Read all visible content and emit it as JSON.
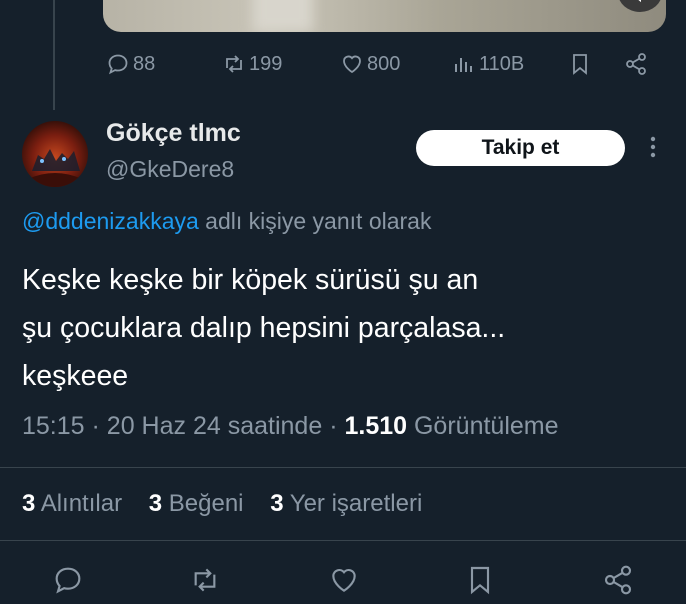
{
  "prev_tweet": {
    "replies": "88",
    "retweets": "199",
    "likes": "800",
    "views": "110B"
  },
  "tweet": {
    "author_name": "Gökçe tlmc",
    "author_handle": "@GkeDere8",
    "follow_label": "Takip et",
    "reply_mention": "@dddenizakkaya",
    "reply_suffix": " adlı kişiye yanıt olarak",
    "text": "Keşke keşke bir köpek sürüsü şu an\nşu çocuklara dalıp hepsini parçalasa...\nkeşkeee",
    "time": "15:15",
    "date": "20 Haz 24 saatinde",
    "views_count": "1.510",
    "views_label": "Görüntüleme"
  },
  "stats": {
    "quotes_count": "3",
    "quotes_label": "Alıntılar",
    "likes_count": "3",
    "likes_label": "Beğeni",
    "bookmarks_count": "3",
    "bookmarks_label": "Yer işaretleri"
  },
  "icons": [
    "reply-icon",
    "retweet-icon",
    "like-icon",
    "views-icon",
    "bookmark-icon",
    "share-icon",
    "more-icon",
    "mute-icon"
  ],
  "colors": {
    "background": "#15202b",
    "accent": "#1d9bf0",
    "muted": "#8b98a5"
  }
}
